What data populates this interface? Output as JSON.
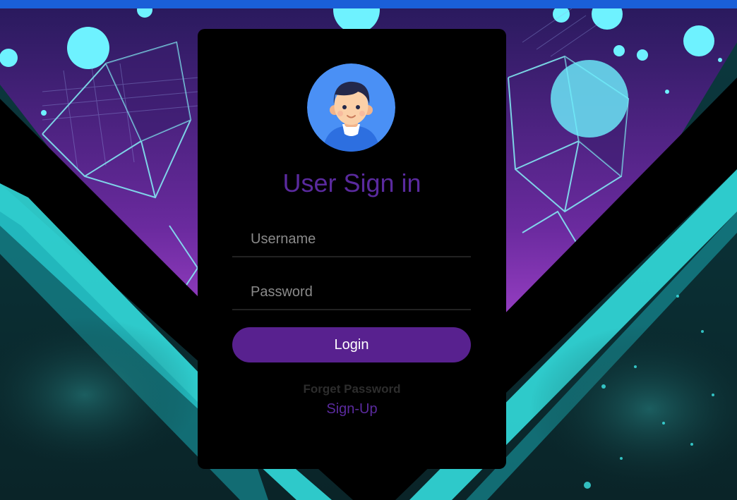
{
  "colors": {
    "top_bar": "#1a5fd8",
    "accent_purple": "#58218f",
    "title_purple": "#5a2a9e",
    "card_background": "#000000",
    "avatar_background": "#4a90f5"
  },
  "avatar": {
    "icon": "user-avatar-icon"
  },
  "form": {
    "title": "User Sign in",
    "username_placeholder": "Username",
    "password_placeholder": "Password",
    "login_label": "Login",
    "forget_label": "Forget Password",
    "signup_label": "Sign-Up"
  }
}
